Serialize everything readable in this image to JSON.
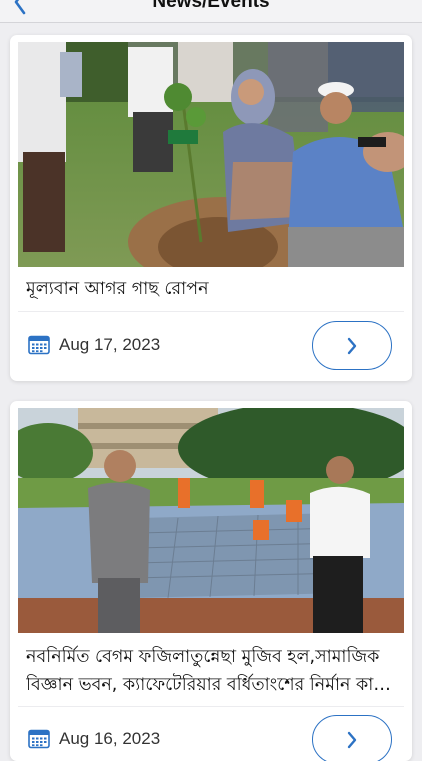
{
  "header": {
    "title": "News/Events",
    "back_icon": "chevron-left-icon"
  },
  "accent_color": "#2c72c4",
  "news": [
    {
      "title": "মূল্যবান আগর গাছ রোপন",
      "date": "Aug 17, 2023",
      "calendar_icon": "calendar-icon",
      "open_icon": "chevron-right-icon"
    },
    {
      "title": "নবনির্মিত বেগম ফজিলাতুন্নেছা মুজিব হল,সামাজিক বিজ্ঞান ভবন, ক্যাফেটেরিয়ার বর্ধিতাংশের নির্মান কাজ পরিদর্শন",
      "date": "Aug 16, 2023",
      "calendar_icon": "calendar-icon",
      "open_icon": "chevron-right-icon"
    }
  ]
}
